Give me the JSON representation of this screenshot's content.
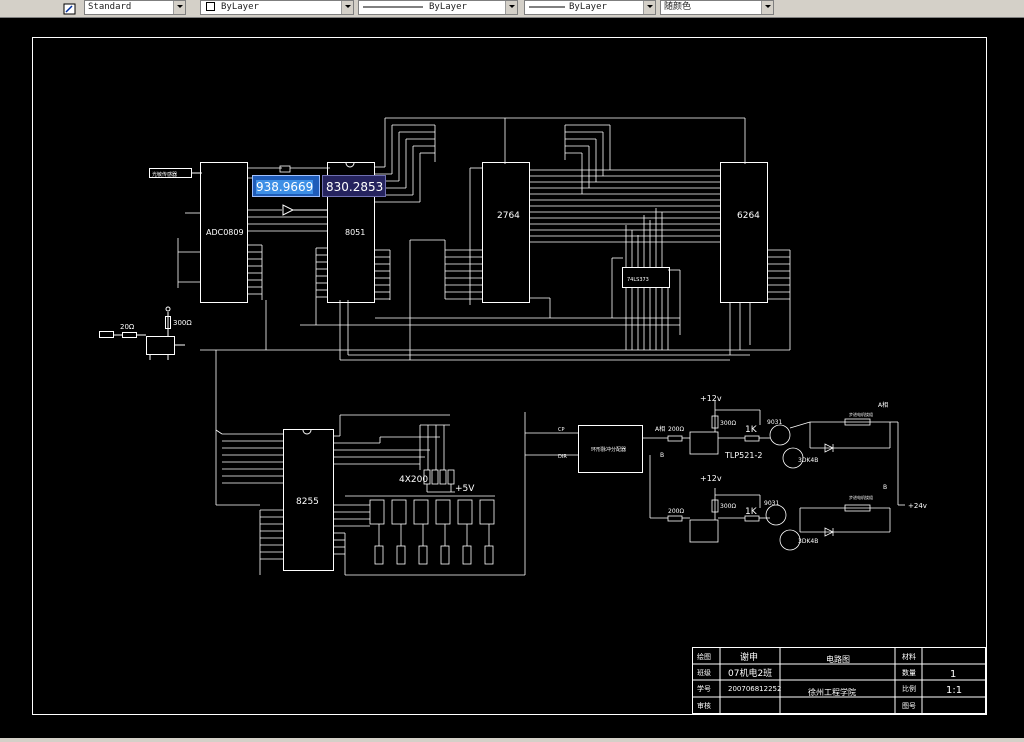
{
  "toolbar": {
    "textstyle": "Standard",
    "layer": "ByLayer",
    "linetype": "ByLayer",
    "lineweight": "ByLayer",
    "color": "随颜色"
  },
  "dynamic_input": {
    "x": "938.9669",
    "y": "830.2853"
  },
  "chips": {
    "sensor": "光敏传感器",
    "adc": "ADC0809",
    "mcu": "8051",
    "eprom": "2764",
    "ram": "6264",
    "ppi": "8255",
    "latch": "74LS373"
  },
  "labels": {
    "r_20": "20Ω",
    "r_300": "300Ω",
    "r_4x200": "4X200",
    "plus5v": "+5V",
    "plus12a": "+12v",
    "plus12b": "+12v",
    "driver": "环形脉冲分配器",
    "cp": "CP",
    "dir": "DIR",
    "a_phase": "A相",
    "b_phase": "B",
    "r_200a": "200Ω",
    "r_200b": "200Ω",
    "r_300a": "300Ω",
    "r_300b": "300Ω",
    "k1a": "1K",
    "k1b": "1K",
    "tlp": "TLP521-2",
    "q1": "9031",
    "q2": "9031",
    "q3": "3DK4B",
    "q4": "3DK4B",
    "coil_a": "A相",
    "coil_b": "B",
    "coil_a_text": "步进电机绕组",
    "coil_b_text": "步进电机绕组",
    "plus24": "+24v"
  },
  "title_block": {
    "r1": [
      "绘图",
      "谢申",
      "",
      "",
      "材料",
      ""
    ],
    "r2": [
      "班级",
      "07机电2班",
      "",
      "电路图",
      "数量",
      "1"
    ],
    "r3": [
      "学号",
      "200706812252",
      "",
      "",
      "比例",
      "1:1"
    ],
    "r4": [
      "审核",
      "",
      "",
      "徐州工程学院",
      "图号",
      ""
    ]
  },
  "colors": {
    "canvas": "#000000",
    "lines": "#ffffff",
    "input_active": "#1e5bb8",
    "input_inactive": "#25235e"
  }
}
